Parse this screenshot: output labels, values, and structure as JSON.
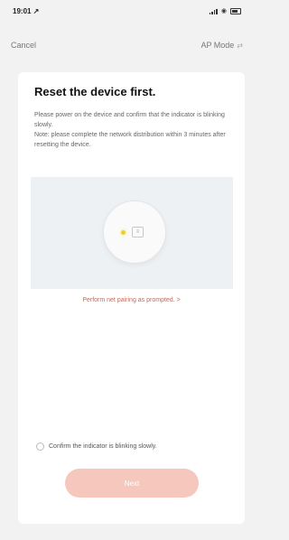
{
  "status": {
    "time": "19:01 ↗"
  },
  "nav": {
    "cancel": "Cancel",
    "mode": "AP Mode",
    "mode_arrow": "⇄"
  },
  "card": {
    "title": "Reset the device first.",
    "desc_line1": "Please power on the device and confirm that the indicator is blinking slowly.",
    "desc_line2": "Note: please complete the network distribution within 3 minutes after resetting the device.",
    "pairing_link": "Perform net pairing as prompted. >",
    "confirm_label": "Confirm the indicator is blinking slowly.",
    "next_button": "Next"
  },
  "colors": {
    "accent": "#f6c7bd",
    "link": "#c46a5b",
    "led": "#e9d12a"
  }
}
